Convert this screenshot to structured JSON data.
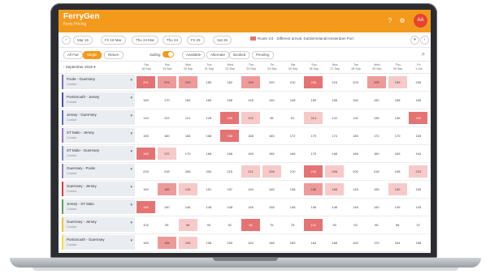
{
  "app": {
    "name": "FerryGen",
    "subtitle": "Ferry Pricing",
    "avatar_initials": "AA",
    "accent_color": "#f39a1c"
  },
  "filters": {
    "chips": [
      "Mar 16",
      "Fri 18 Mar",
      "Thu 24 Mar",
      "Thu 24",
      "Fri 25",
      "Sat 26"
    ],
    "route": "Route 1/4 · Different arrival, Dublin/Ireland/Amsterdam Port"
  },
  "options": {
    "tabs": [
      "All Fair",
      "Single",
      "Return"
    ],
    "active_tab": "Single",
    "toggle_label": "Sailing",
    "buttons": [
      "Available",
      "Alternate",
      "Booked",
      "Pending"
    ]
  },
  "calendar": {
    "month": "September 2016",
    "days": [
      [
        "Sat",
        "18 Sep"
      ],
      [
        "Sun",
        "19 Sep"
      ],
      [
        "Mon",
        "20 Sep"
      ],
      [
        "Tue",
        "21 Sep"
      ],
      [
        "Wed",
        "22 Sep"
      ],
      [
        "Thu",
        "23 Sep"
      ],
      [
        "Fri",
        "24 Sep"
      ],
      [
        "Sat",
        "25 Sep"
      ],
      [
        "Sun",
        "26 Sep"
      ],
      [
        "Mon",
        "27 Sep"
      ],
      [
        "Tue",
        "28 Sep"
      ],
      [
        "Wed",
        "29 Sep"
      ],
      [
        "Thu",
        "30 Sep"
      ],
      [
        "Fri",
        "1 Oct"
      ]
    ]
  },
  "rows": [
    {
      "title": "Poole - Guernsey",
      "sub": "Condor",
      "color": "#7b6bc2",
      "values": [
        "201",
        "204",
        "209",
        "185",
        "182",
        "199",
        "220",
        "210",
        "228",
        "215",
        "209",
        "208",
        "199",
        "205"
      ],
      "heat": [
        3,
        2,
        2,
        0,
        0,
        2,
        0,
        0,
        3,
        0,
        0,
        2,
        1,
        0
      ]
    },
    {
      "title": "Portsmouth - Jersey",
      "sub": "Condor",
      "color": "#3f51b5",
      "values": [
        "180",
        "170",
        "165",
        "165",
        "168",
        "148",
        "140",
        "148",
        "150",
        "158",
        "160",
        "150",
        "158",
        "165"
      ],
      "heat": [
        0,
        0,
        0,
        0,
        0,
        0,
        0,
        0,
        0,
        0,
        0,
        0,
        0,
        0
      ]
    },
    {
      "title": "Jersey - Guernsey",
      "sub": "Condor",
      "color": "#5c6bc0",
      "values": [
        "115",
        "122",
        "121",
        "128",
        "185",
        "102",
        "98",
        "91",
        "114",
        "122",
        "132",
        "135",
        "136",
        "192"
      ],
      "heat": [
        0,
        0,
        0,
        0,
        3,
        1,
        0,
        0,
        1,
        0,
        0,
        0,
        0,
        3
      ]
    },
    {
      "title": "ST Malo - Jersey",
      "sub": "Condor",
      "color": "#9575cd",
      "values": [
        "150",
        "160",
        "166",
        "168",
        "188",
        "168",
        "165",
        "172",
        "170",
        "174",
        "180",
        "172",
        "170",
        "165"
      ],
      "heat": [
        0,
        0,
        0,
        0,
        3,
        0,
        0,
        0,
        0,
        0,
        0,
        0,
        0,
        0
      ]
    },
    {
      "title": "ST Malo - Guernsey",
      "sub": "Condor",
      "color": "#7986cb",
      "values": [
        "180",
        "172",
        "170",
        "168",
        "166",
        "165",
        "165",
        "166",
        "170",
        "168",
        "166",
        "160",
        "165",
        "164"
      ],
      "heat": [
        3,
        1,
        0,
        0,
        0,
        0,
        0,
        0,
        0,
        0,
        0,
        0,
        0,
        0
      ]
    },
    {
      "title": "Guernsey - Poole",
      "sub": "Condor",
      "color": "#8e7cc3",
      "values": [
        "225",
        "218",
        "208",
        "200",
        "215",
        "221",
        "208",
        "210",
        "240",
        "208",
        "200",
        "218",
        "198",
        "223"
      ],
      "heat": [
        0,
        0,
        0,
        0,
        0,
        1,
        1,
        0,
        3,
        1,
        0,
        0,
        0,
        1
      ]
    },
    {
      "title": "Guernsey - Jersey",
      "sub": "Condor",
      "color": "#e53935",
      "values": [
        "150",
        "185",
        "145",
        "151",
        "157",
        "140",
        "145",
        "138",
        "185",
        "168",
        "145",
        "155",
        "140",
        "155"
      ],
      "heat": [
        0,
        2,
        1,
        0,
        0,
        0,
        0,
        0,
        2,
        1,
        0,
        0,
        1,
        0
      ]
    },
    {
      "title": "Jersey - ST Malo",
      "sub": "Condor",
      "color": "#5e9c5a",
      "values": [
        "150",
        "140",
        "146",
        "148",
        "148",
        "145",
        "148",
        "146",
        "146",
        "148",
        "145",
        "140",
        "145",
        "145"
      ],
      "heat": [
        3,
        0,
        0,
        0,
        0,
        0,
        0,
        0,
        0,
        0,
        0,
        0,
        0,
        0
      ]
    },
    {
      "title": "Guernsey - Jersey",
      "sub": "Condor",
      "color": "#fbc02d",
      "values": [
        "102",
        "95",
        "98",
        "90",
        "92",
        "96",
        "75",
        "75",
        "101",
        "90",
        "93",
        "95",
        "98",
        "97"
      ],
      "heat": [
        0,
        0,
        1,
        0,
        0,
        3,
        0,
        0,
        3,
        0,
        0,
        0,
        0,
        0
      ]
    },
    {
      "title": "Portsmouth - Guernsey",
      "sub": "Condor",
      "color": "#fdd835",
      "values": [
        "160",
        "158",
        "155",
        "158",
        "150",
        "162",
        "158",
        "160",
        "164",
        "168",
        "162",
        "170",
        "164",
        "158"
      ],
      "heat": [
        0,
        2,
        1,
        0,
        0,
        0,
        0,
        0,
        0,
        0,
        0,
        0,
        0,
        0
      ]
    }
  ]
}
